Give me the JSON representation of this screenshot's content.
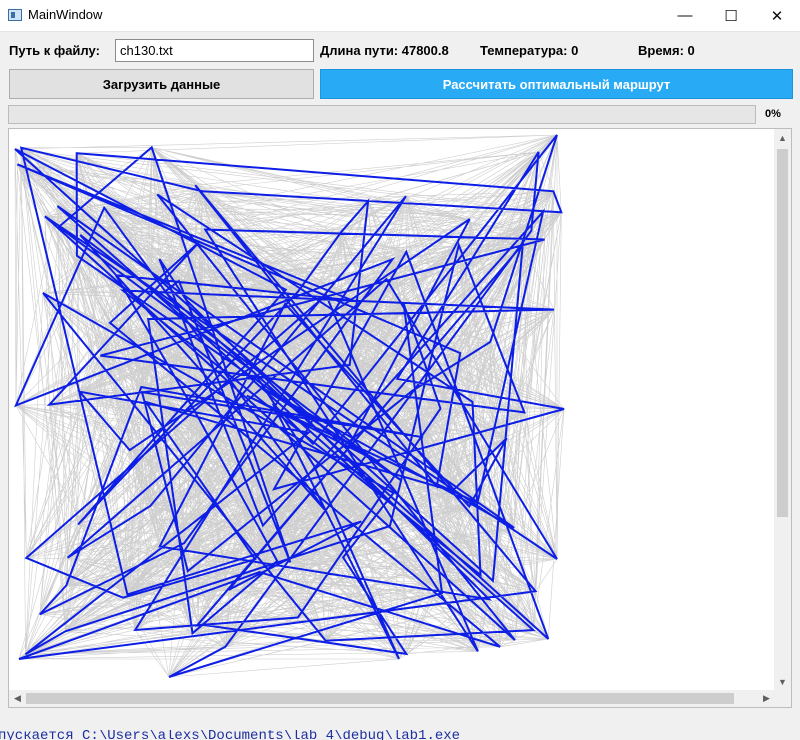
{
  "window": {
    "title": "MainWindow",
    "controls": {
      "minimize": "—",
      "maximize": "☐",
      "close": "✕"
    }
  },
  "form": {
    "path_label": "Путь к файлу:",
    "path_value": "ch130.txt",
    "length_label": "Длина пути: 47800.8",
    "temperature_label": "Температура: 0",
    "time_label": "Время: 0"
  },
  "buttons": {
    "load": "Загрузить данные",
    "calculate": "Рассчитать оптимальный маршрут"
  },
  "progress": {
    "value": 0,
    "text": "0%"
  },
  "plot": {
    "route_color": "#0d1ee6",
    "edge_color": "#a6a6a6",
    "background": "#ffffff"
  },
  "console_text": "пускается C:\\Users\\alexs\\Documents\\lab_4\\debug\\lab1.exe"
}
